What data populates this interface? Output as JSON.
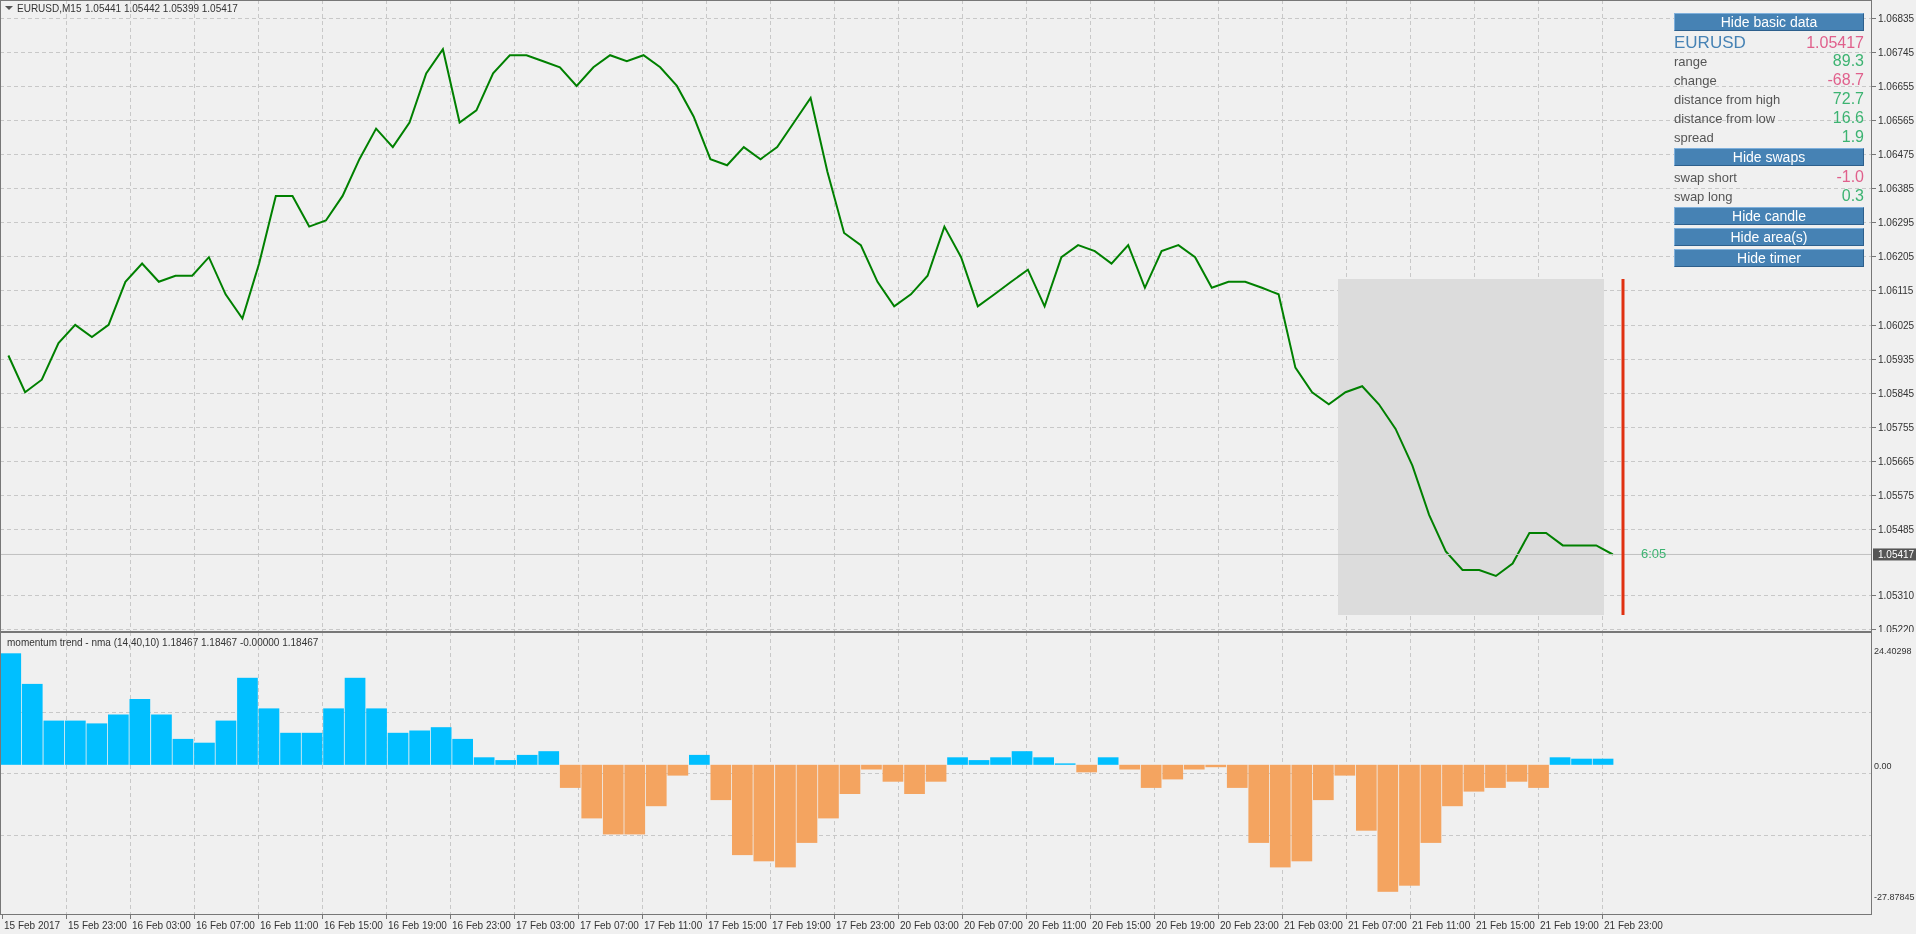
{
  "chart_header": {
    "symbol_timeframe": "EURUSD,M15",
    "ohlc": "1.05441 1.05442 1.05399 1.05417"
  },
  "price_chart": {
    "chart_data": {
      "type": "line",
      "grid": true,
      "ylim": [
        1.05212,
        1.06883
      ],
      "ref_lines": [
        {
          "axis": "y",
          "value": 1.05417
        }
      ],
      "series": [
        {
          "color": "#008000",
          "values": [
            1.05943,
            1.05846,
            1.05879,
            1.05976,
            1.06024,
            1.05992,
            1.06024,
            1.06138,
            1.06186,
            1.06138,
            1.06154,
            1.06154,
            1.06203,
            1.06105,
            1.06041,
            1.06186,
            1.06365,
            1.06365,
            1.06284,
            1.063,
            1.06365,
            1.06462,
            1.06543,
            1.06494,
            1.06559,
            1.06689,
            1.06753,
            1.06559,
            1.06591,
            1.06689,
            1.06737,
            1.06737,
            1.06721,
            1.06705,
            1.06656,
            1.06705,
            1.06737,
            1.06721,
            1.06737,
            1.06705,
            1.06656,
            1.06575,
            1.06462,
            1.06446,
            1.06494,
            1.06462,
            1.06494,
            1.06559,
            1.06624,
            1.06429,
            1.06267,
            1.06235,
            1.06138,
            1.06073,
            1.06105,
            1.06154,
            1.06284,
            1.06203,
            1.06073,
            1.06105,
            1.06138,
            1.0617,
            1.06073,
            1.06203,
            1.06235,
            1.06219,
            1.06186,
            1.06235,
            1.06122,
            1.06219,
            1.06235,
            1.06203,
            1.06122,
            1.06138,
            1.06138,
            1.06122,
            1.06105,
            1.05911,
            1.05846,
            1.05814,
            1.05846,
            1.05862,
            1.05814,
            1.05749,
            1.05652,
            1.05522,
            1.05425,
            1.05376,
            1.05376,
            1.0536,
            1.05393,
            1.05474,
            1.05474,
            1.05441,
            1.05441,
            1.05441,
            1.05417,
            null,
            null,
            null,
            null,
            null,
            null,
            null,
            null,
            null,
            null,
            null,
            null,
            null,
            null,
            null
          ]
        }
      ],
      "yticks": [
        {
          "value": 1.06835,
          "label": "1.06835"
        },
        {
          "value": 1.06745,
          "label": "1.06745"
        },
        {
          "value": 1.06655,
          "label": "1.06655"
        },
        {
          "value": 1.06565,
          "label": "1.06565"
        },
        {
          "value": 1.06475,
          "label": "1.06475"
        },
        {
          "value": 1.06385,
          "label": "1.06385"
        },
        {
          "value": 1.06295,
          "label": "1.06295"
        },
        {
          "value": 1.06205,
          "label": "1.06205"
        },
        {
          "value": 1.06115,
          "label": "1.06115"
        },
        {
          "value": 1.06025,
          "label": "1.06025"
        },
        {
          "value": 1.05935,
          "label": "1.05935"
        },
        {
          "value": 1.05845,
          "label": "1.05845"
        },
        {
          "value": 1.05755,
          "label": "1.05755"
        },
        {
          "value": 1.05665,
          "label": "1.05665"
        },
        {
          "value": 1.05575,
          "label": "1.05575"
        },
        {
          "value": 1.05485,
          "label": "1.05485"
        },
        {
          "value": 1.0531,
          "label": "1.05310"
        },
        {
          "value": 1.0522,
          "label": "1.05220"
        }
      ]
    },
    "current_price": "1.05417",
    "timer": "6:05"
  },
  "info_panel": {
    "items": [
      {
        "kind": "button",
        "label": "Hide basic data"
      },
      {
        "kind": "symbol",
        "label": "EURUSD",
        "value": "1.05417",
        "color": "#e0608c"
      },
      {
        "kind": "stat",
        "label": "range",
        "value": "89.3",
        "color": "#3cb371"
      },
      {
        "kind": "stat",
        "label": "change",
        "value": "-68.7",
        "color": "#e0608c"
      },
      {
        "kind": "stat",
        "label": "distance from high",
        "value": "72.7",
        "color": "#3cb371"
      },
      {
        "kind": "stat",
        "label": "distance from low",
        "value": "16.6",
        "color": "#3cb371"
      },
      {
        "kind": "stat",
        "label": "spread",
        "value": "1.9",
        "color": "#3cb371"
      },
      {
        "kind": "button",
        "label": "Hide swaps"
      },
      {
        "kind": "stat",
        "label": "swap short",
        "value": "-1.0",
        "color": "#e0608c"
      },
      {
        "kind": "stat",
        "label": "swap long",
        "value": "0.3",
        "color": "#3cb371"
      },
      {
        "kind": "button",
        "label": "Hide candle"
      },
      {
        "kind": "button",
        "label": "Hide area(s)"
      },
      {
        "kind": "button",
        "label": "Hide timer"
      }
    ]
  },
  "indicator": {
    "title": "momentum trend - nma (14,40,10) 1.18467 1.18467 -0.00000 1.18467",
    "chart_data": {
      "type": "bar",
      "stacked": true,
      "grid": true,
      "ylim": [
        -31.92,
        28.23
      ],
      "series": [
        {
          "color": "#00bfff",
          "values": [
            23.7,
            17.2,
            9.4,
            9.4,
            8.8,
            10.7,
            14,
            10.7,
            5.5,
            4.7,
            9.4,
            18.5,
            12,
            6.8,
            6.8,
            12,
            18.5,
            12,
            6.8,
            7.3,
            8,
            5.5,
            1.6,
            1,
            2.1,
            2.9,
            null,
            null,
            null,
            null,
            null,
            null,
            2.1,
            null,
            null,
            null,
            null,
            null,
            null,
            null,
            null,
            null,
            null,
            null,
            1.6,
            1,
            1.6,
            2.9,
            1.6,
            0.3,
            null,
            1.6,
            null,
            null,
            null,
            null,
            null,
            null,
            null,
            null,
            null,
            null,
            null,
            null,
            null,
            null,
            null,
            null,
            null,
            null,
            null,
            null,
            1.6,
            1.3,
            1.3,
            null,
            null,
            null,
            null,
            null,
            null,
            null,
            null,
            null,
            null,
            null,
            null
          ]
        },
        {
          "color": "#f4a460",
          "values": [
            null,
            null,
            null,
            null,
            null,
            null,
            null,
            null,
            null,
            null,
            null,
            null,
            null,
            null,
            null,
            null,
            null,
            null,
            null,
            null,
            null,
            null,
            null,
            null,
            null,
            null,
            -4.9,
            -11.4,
            -14.8,
            -14.8,
            -8.8,
            -2.3,
            null,
            -7.5,
            -19.2,
            -20.5,
            -21.8,
            -16.6,
            -11.4,
            -6.2,
            -1,
            -3.6,
            -6.2,
            -3.6,
            null,
            null,
            null,
            null,
            null,
            null,
            -1.6,
            null,
            -1,
            -4.9,
            -3.1,
            -1,
            -0.5,
            -4.9,
            -16.6,
            -21.8,
            -20.5,
            -7.5,
            -2.3,
            -14,
            -27,
            -25.7,
            -16.6,
            -8.8,
            -5.7,
            -4.9,
            -3.6,
            -4.9,
            null,
            null,
            null,
            null,
            null,
            null,
            null,
            null,
            null,
            null,
            null,
            null,
            null,
            null,
            null
          ]
        }
      ],
      "yticks": [
        {
          "value": 24.40298,
          "label": "24.40298"
        },
        {
          "value": 0,
          "label": "0.00"
        },
        {
          "value": -27.87845,
          "label": "-27.87845"
        }
      ]
    }
  },
  "time_axis": [
    "15 Feb 2017",
    "15 Feb 23:00",
    "16 Feb 03:00",
    "16 Feb 07:00",
    "16 Feb 11:00",
    "16 Feb 15:00",
    "16 Feb 19:00",
    "16 Feb 23:00",
    "17 Feb 03:00",
    "17 Feb 07:00",
    "17 Feb 11:00",
    "17 Feb 15:00",
    "17 Feb 19:00",
    "17 Feb 23:00",
    "20 Feb 03:00",
    "20 Feb 07:00",
    "20 Feb 11:00",
    "20 Feb 15:00",
    "20 Feb 19:00",
    "20 Feb 23:00",
    "21 Feb 03:00",
    "21 Feb 07:00",
    "21 Feb 11:00",
    "21 Feb 15:00",
    "21 Feb 19:00",
    "21 Feb 23:00"
  ]
}
